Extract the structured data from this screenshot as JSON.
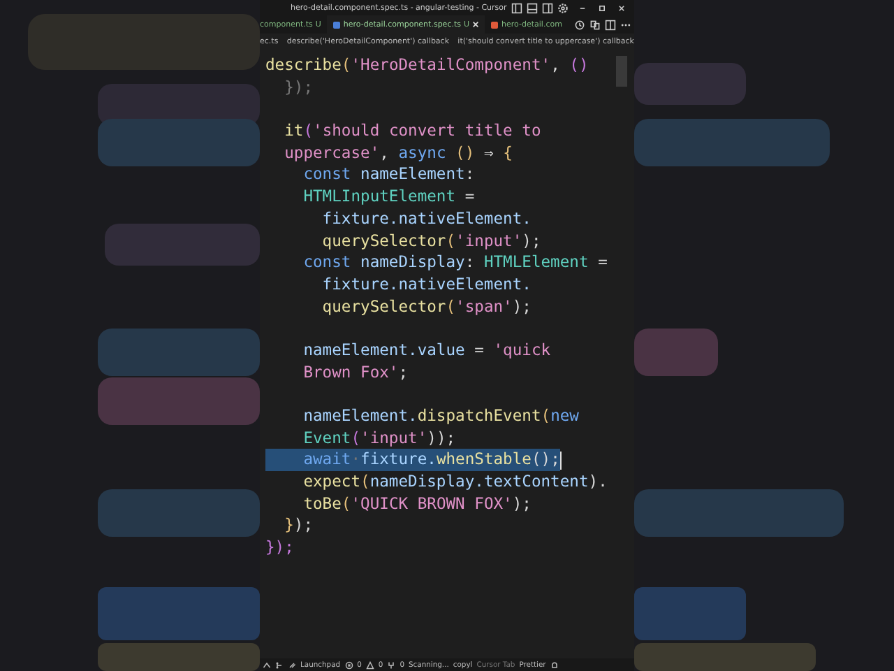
{
  "window": {
    "title": "hero-detail.component.spec.ts - angular-testing - Cursor"
  },
  "tabs": [
    {
      "label": "component.ts",
      "badge": "U",
      "selected": false
    },
    {
      "label": "hero-detail.component.spec.ts",
      "badge": "U",
      "selected": true,
      "kind": "angular"
    },
    {
      "label": "hero-detail.com",
      "selected": false,
      "kind": "html"
    }
  ],
  "breadcrumb": [
    "ec.ts",
    "describe('HeroDetailComponent') callback",
    "it('should convert title to uppercase') callback"
  ],
  "code": [
    {
      "selected": false,
      "tokens": [
        {
          "t": "describe",
          "kind": "fn"
        },
        {
          "t": "(",
          "kind": "b1"
        },
        {
          "t": "'HeroDetailComponent'",
          "kind": "str"
        },
        {
          "t": ", ",
          "kind": "p"
        },
        {
          "t": "()",
          "kind": "b2"
        }
      ]
    },
    {
      "selected": false,
      "tokens": [
        {
          "t": "  });",
          "kind": "dim"
        }
      ]
    },
    {
      "selected": false
    },
    {
      "selected": false,
      "tokens": [
        {
          "t": "  it",
          "kind": "fn"
        },
        {
          "t": "(",
          "kind": "b2"
        },
        {
          "t": "'should convert title to",
          "kind": "str"
        }
      ]
    },
    {
      "selected": false,
      "tokens": [
        {
          "t": "  uppercase'",
          "kind": "str"
        },
        {
          "t": ", ",
          "kind": "p"
        },
        {
          "t": "async",
          "kind": "kw"
        },
        {
          "t": " () ",
          "kind": "b3"
        },
        {
          "t": "⇒ ",
          "kind": "p"
        },
        {
          "t": "{",
          "kind": "b3"
        }
      ]
    },
    {
      "selected": false,
      "tokens": [
        {
          "t": "    const ",
          "kind": "kw"
        },
        {
          "t": "nameElement",
          "kind": "var"
        },
        {
          "t": ":",
          "kind": "p"
        }
      ]
    },
    {
      "selected": false,
      "tokens": [
        {
          "t": "    HTMLInputElement",
          "kind": "type"
        },
        {
          "t": " =",
          "kind": "p"
        }
      ]
    },
    {
      "selected": false,
      "tokens": [
        {
          "t": "      fixture.nativeElement.",
          "kind": "var"
        }
      ]
    },
    {
      "selected": false,
      "tokens": [
        {
          "t": "      querySelector",
          "kind": "fn"
        },
        {
          "t": "(",
          "kind": "b1"
        },
        {
          "t": "'input'",
          "kind": "str"
        },
        {
          "t": ");",
          "kind": "p"
        }
      ]
    },
    {
      "selected": false,
      "tokens": [
        {
          "t": "    const ",
          "kind": "kw"
        },
        {
          "t": "nameDisplay",
          "kind": "var"
        },
        {
          "t": ": ",
          "kind": "p"
        },
        {
          "t": "HTMLElement",
          "kind": "type"
        },
        {
          "t": " =",
          "kind": "p"
        }
      ]
    },
    {
      "selected": false,
      "tokens": [
        {
          "t": "      fixture.nativeElement.",
          "kind": "var"
        }
      ]
    },
    {
      "selected": false,
      "tokens": [
        {
          "t": "      querySelector",
          "kind": "fn"
        },
        {
          "t": "(",
          "kind": "b1"
        },
        {
          "t": "'span'",
          "kind": "str"
        },
        {
          "t": ");",
          "kind": "p"
        }
      ]
    },
    {
      "selected": false
    },
    {
      "selected": false,
      "tokens": [
        {
          "t": "    nameElement.value",
          "kind": "var"
        },
        {
          "t": " = ",
          "kind": "p"
        },
        {
          "t": "'quick",
          "kind": "str"
        }
      ]
    },
    {
      "selected": false,
      "tokens": [
        {
          "t": "    Brown Fox'",
          "kind": "str"
        },
        {
          "t": ";",
          "kind": "p"
        }
      ]
    },
    {
      "selected": false
    },
    {
      "selected": false,
      "tokens": [
        {
          "t": "    nameElement.",
          "kind": "var"
        },
        {
          "t": "dispatchEvent",
          "kind": "fn"
        },
        {
          "t": "(",
          "kind": "b1"
        },
        {
          "t": "new",
          "kind": "kw"
        }
      ]
    },
    {
      "selected": false,
      "tokens": [
        {
          "t": "    Event",
          "kind": "type"
        },
        {
          "t": "(",
          "kind": "b2"
        },
        {
          "t": "'input'",
          "kind": "str"
        },
        {
          "t": "));",
          "kind": "p"
        }
      ]
    },
    {
      "selected": true,
      "tokens": [
        {
          "t": "    await",
          "kind": "ctl"
        },
        {
          "t": "·",
          "kind": "dim"
        },
        {
          "t": "fixture.",
          "kind": "var"
        },
        {
          "t": "whenStable",
          "kind": "fn"
        },
        {
          "t": "();",
          "kind": "p"
        }
      ]
    },
    {
      "selected": false,
      "tokens": [
        {
          "t": "    expect",
          "kind": "fn"
        },
        {
          "t": "(",
          "kind": "b1"
        },
        {
          "t": "nameDisplay.textContent",
          "kind": "var"
        },
        {
          "t": ").",
          "kind": "p"
        }
      ]
    },
    {
      "selected": false,
      "tokens": [
        {
          "t": "    toBe",
          "kind": "fn"
        },
        {
          "t": "(",
          "kind": "b1"
        },
        {
          "t": "'QUICK BROWN FOX'",
          "kind": "str"
        },
        {
          "t": ");",
          "kind": "p"
        }
      ]
    },
    {
      "selected": false,
      "tokens": [
        {
          "t": "  }",
          "kind": "b3"
        },
        {
          "t": ");",
          "kind": "p"
        }
      ]
    },
    {
      "selected": false,
      "tokens": [
        {
          "t": "});",
          "kind": "b2"
        }
      ]
    }
  ],
  "status_bar": {
    "items": [
      "Launchpad",
      "0",
      "0",
      "0",
      "Scanning...",
      "copyl",
      "Cursor Tab",
      "Prettier"
    ]
  }
}
